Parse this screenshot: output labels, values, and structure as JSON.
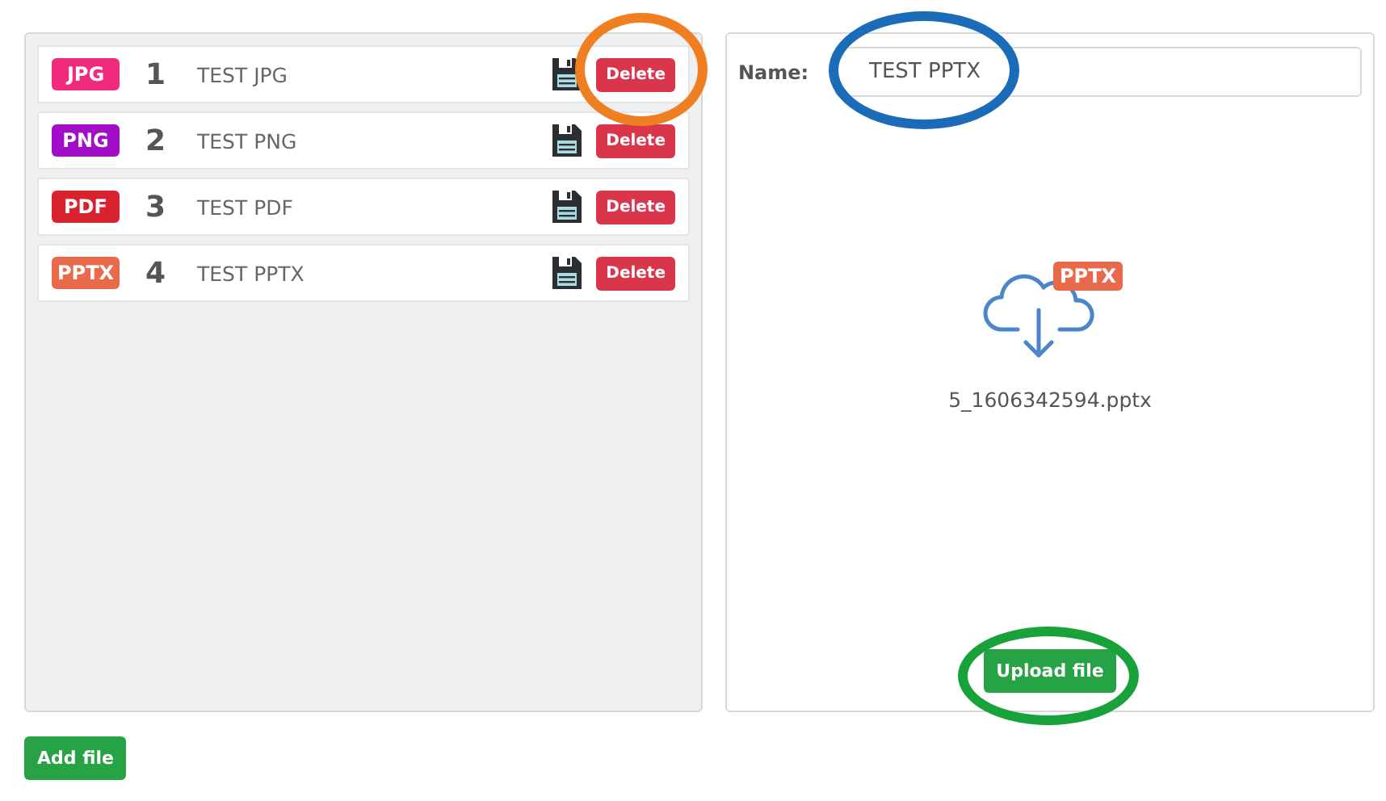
{
  "files": [
    {
      "type": "JPG",
      "color": "#f02a7c",
      "number": "1",
      "name": "TEST JPG",
      "delete": "Delete"
    },
    {
      "type": "PNG",
      "color": "#a20ec8",
      "number": "2",
      "name": "TEST PNG",
      "delete": "Delete"
    },
    {
      "type": "PDF",
      "color": "#d8232f",
      "number": "3",
      "name": "TEST PDF",
      "delete": "Delete"
    },
    {
      "type": "PPTX",
      "color": "#e86a4b",
      "number": "4",
      "name": "TEST PPTX",
      "delete": "Delete"
    }
  ],
  "detail": {
    "name_label": "Name:",
    "name_value": "TEST PPTX",
    "file_badge": {
      "text": "PPTX",
      "color": "#e86a4b"
    },
    "filename": "5_1606342594.pptx",
    "upload": "Upload file"
  },
  "add_file": "Add file",
  "annotations": [
    {
      "color": "#f07f22"
    },
    {
      "color": "#1a6cb8"
    },
    {
      "color": "#17a23a"
    }
  ]
}
